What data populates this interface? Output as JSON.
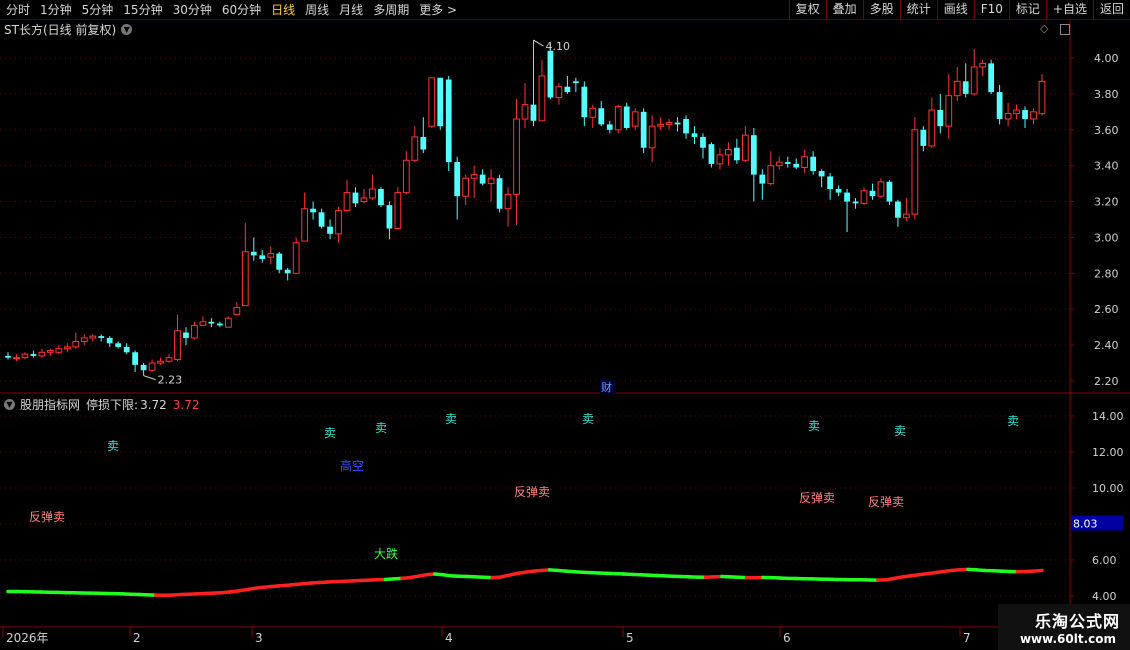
{
  "toolbar": {
    "periods": [
      "分时",
      "1分钟",
      "5分钟",
      "15分钟",
      "30分钟",
      "60分钟",
      "日线",
      "周线",
      "月线",
      "多周期",
      "更多"
    ],
    "active_period": "日线",
    "more_arrow": ">",
    "buttons": [
      "复权",
      "叠加",
      "多股",
      "统计",
      "画线",
      "F10",
      "标记",
      "+自选",
      "返回"
    ]
  },
  "main_chart": {
    "title": "ST长方(日线 前复权)",
    "icons": [
      "diamond-icon",
      "window-icon"
    ],
    "y_ticks": [
      "4.00",
      "3.80",
      "3.60",
      "3.40",
      "3.20",
      "3.00",
      "2.80",
      "2.60",
      "2.40",
      "2.20"
    ],
    "high_label": "4.10",
    "low_label": "2.23",
    "marker": "财"
  },
  "indicator": {
    "name": "股朋指标网",
    "stop_label": "停损下限:",
    "stop_value": "3.72",
    "stop_value_red": "3.72",
    "y_ticks": [
      "14.00",
      "12.00",
      "10.00",
      "8.00",
      "6.00",
      "4.00"
    ],
    "current_value": "8.03",
    "signals": [
      {
        "text": "卖",
        "color": "#40e0d0"
      },
      {
        "text": "卖",
        "color": "#40e0d0"
      },
      {
        "text": "卖",
        "color": "#40e0d0"
      },
      {
        "text": "卖",
        "color": "#40e0d0"
      },
      {
        "text": "卖",
        "color": "#40e0d0"
      },
      {
        "text": "卖",
        "color": "#40e0d0"
      },
      {
        "text": "卖",
        "color": "#40e0d0"
      },
      {
        "text": "卖",
        "color": "#40e0d0"
      },
      {
        "text": "高空",
        "color": "#3050ff"
      },
      {
        "text": "反弹卖",
        "color": "#ff8080"
      },
      {
        "text": "反弹卖",
        "color": "#ff8080"
      },
      {
        "text": "反弹卖",
        "color": "#ff8080"
      },
      {
        "text": "反弹卖",
        "color": "#ff8080"
      },
      {
        "text": "大跌",
        "color": "#40ff40"
      }
    ]
  },
  "x_axis": {
    "labels": [
      "2026年",
      "2",
      "3",
      "4",
      "5",
      "6",
      "7"
    ]
  },
  "chart_data": {
    "type": "candlestick",
    "title": "ST长方(日线 前复权)",
    "ylim": [
      2.13,
      4.16
    ],
    "candles": [
      [
        2.34,
        2.33,
        2.36,
        2.32
      ],
      [
        2.33,
        2.33,
        2.35,
        2.31
      ],
      [
        2.33,
        2.35,
        2.36,
        2.32
      ],
      [
        2.35,
        2.34,
        2.37,
        2.33
      ],
      [
        2.34,
        2.36,
        2.38,
        2.33
      ],
      [
        2.36,
        2.37,
        2.38,
        2.34
      ],
      [
        2.36,
        2.38,
        2.4,
        2.35
      ],
      [
        2.38,
        2.39,
        2.41,
        2.36
      ],
      [
        2.39,
        2.42,
        2.47,
        2.38
      ],
      [
        2.42,
        2.44,
        2.46,
        2.4
      ],
      [
        2.44,
        2.45,
        2.46,
        2.42
      ],
      [
        2.45,
        2.44,
        2.46,
        2.42
      ],
      [
        2.44,
        2.41,
        2.45,
        2.39
      ],
      [
        2.41,
        2.39,
        2.42,
        2.38
      ],
      [
        2.39,
        2.36,
        2.41,
        2.35
      ],
      [
        2.36,
        2.29,
        2.37,
        2.25
      ],
      [
        2.29,
        2.26,
        2.3,
        2.23
      ],
      [
        2.26,
        2.3,
        2.32,
        2.25
      ],
      [
        2.3,
        2.31,
        2.33,
        2.29
      ],
      [
        2.31,
        2.33,
        2.35,
        2.3
      ],
      [
        2.32,
        2.48,
        2.57,
        2.31
      ],
      [
        2.47,
        2.44,
        2.5,
        2.4
      ],
      [
        2.44,
        2.51,
        2.53,
        2.43
      ],
      [
        2.51,
        2.53,
        2.56,
        2.51
      ],
      [
        2.53,
        2.52,
        2.55,
        2.5
      ],
      [
        2.52,
        2.51,
        2.53,
        2.5
      ],
      [
        2.5,
        2.55,
        2.56,
        2.5
      ],
      [
        2.57,
        2.61,
        2.64,
        2.58
      ],
      [
        2.62,
        2.92,
        3.08,
        2.62
      ],
      [
        2.92,
        2.9,
        3.0,
        2.87
      ],
      [
        2.9,
        2.88,
        2.93,
        2.86
      ],
      [
        2.89,
        2.91,
        2.95,
        2.85
      ],
      [
        2.91,
        2.82,
        2.92,
        2.8
      ],
      [
        2.82,
        2.8,
        2.83,
        2.76
      ],
      [
        2.8,
        2.97,
        3.0,
        2.8
      ],
      [
        2.98,
        3.16,
        3.25,
        2.98
      ],
      [
        3.16,
        3.14,
        3.2,
        3.1
      ],
      [
        3.14,
        3.06,
        3.16,
        3.05
      ],
      [
        3.06,
        3.02,
        3.1,
        2.99
      ],
      [
        3.02,
        3.15,
        3.17,
        2.97
      ],
      [
        3.15,
        3.25,
        3.32,
        3.14
      ],
      [
        3.25,
        3.19,
        3.28,
        3.17
      ],
      [
        3.2,
        3.22,
        3.27,
        3.19
      ],
      [
        3.22,
        3.27,
        3.35,
        3.21
      ],
      [
        3.27,
        3.18,
        3.28,
        3.17
      ],
      [
        3.18,
        3.05,
        3.2,
        2.99
      ],
      [
        3.05,
        3.25,
        3.28,
        3.04
      ],
      [
        3.25,
        3.43,
        3.48,
        3.24
      ],
      [
        3.43,
        3.56,
        3.62,
        3.42
      ],
      [
        3.56,
        3.49,
        3.67,
        3.47
      ],
      [
        3.62,
        3.89,
        3.89,
        3.61
      ],
      [
        3.89,
        3.62,
        3.89,
        3.6
      ],
      [
        3.88,
        3.42,
        3.9,
        3.37
      ],
      [
        3.42,
        3.23,
        3.45,
        3.1
      ],
      [
        3.23,
        3.33,
        3.35,
        3.18
      ],
      [
        3.33,
        3.35,
        3.4,
        3.22
      ],
      [
        3.35,
        3.3,
        3.38,
        3.29
      ],
      [
        3.3,
        3.33,
        3.38,
        3.2
      ],
      [
        3.33,
        3.16,
        3.35,
        3.14
      ],
      [
        3.16,
        3.24,
        3.28,
        3.06
      ],
      [
        3.24,
        3.66,
        3.77,
        3.07
      ],
      [
        3.66,
        3.74,
        3.86,
        3.61
      ],
      [
        3.74,
        3.65,
        4.1,
        3.62
      ],
      [
        3.65,
        3.9,
        3.99,
        3.66
      ],
      [
        4.04,
        3.78,
        4.08,
        3.77
      ],
      [
        3.78,
        3.84,
        3.86,
        3.74
      ],
      [
        3.84,
        3.81,
        3.9,
        3.8
      ],
      [
        3.87,
        3.86,
        3.89,
        3.81
      ],
      [
        3.84,
        3.67,
        3.87,
        3.62
      ],
      [
        3.67,
        3.72,
        3.74,
        3.61
      ],
      [
        3.72,
        3.63,
        3.76,
        3.62
      ],
      [
        3.63,
        3.6,
        3.65,
        3.58
      ],
      [
        3.6,
        3.73,
        3.74,
        3.58
      ],
      [
        3.73,
        3.61,
        3.75,
        3.6
      ],
      [
        3.62,
        3.7,
        3.72,
        3.6
      ],
      [
        3.7,
        3.5,
        3.72,
        3.47
      ],
      [
        3.5,
        3.62,
        3.68,
        3.42
      ],
      [
        3.62,
        3.63,
        3.67,
        3.6
      ],
      [
        3.63,
        3.64,
        3.66,
        3.6
      ],
      [
        3.64,
        3.63,
        3.67,
        3.59
      ],
      [
        3.66,
        3.58,
        3.68,
        3.55
      ],
      [
        3.58,
        3.56,
        3.62,
        3.52
      ],
      [
        3.56,
        3.5,
        3.58,
        3.44
      ],
      [
        3.52,
        3.41,
        3.53,
        3.39
      ],
      [
        3.41,
        3.46,
        3.5,
        3.38
      ],
      [
        3.46,
        3.49,
        3.53,
        3.4
      ],
      [
        3.5,
        3.43,
        3.55,
        3.41
      ],
      [
        3.43,
        3.57,
        3.62,
        3.42
      ],
      [
        3.57,
        3.35,
        3.61,
        3.2
      ],
      [
        3.35,
        3.3,
        3.38,
        3.21
      ],
      [
        3.3,
        3.4,
        3.48,
        3.29
      ],
      [
        3.4,
        3.42,
        3.45,
        3.38
      ],
      [
        3.42,
        3.41,
        3.45,
        3.39
      ],
      [
        3.41,
        3.39,
        3.44,
        3.38
      ],
      [
        3.39,
        3.45,
        3.49,
        3.36
      ],
      [
        3.45,
        3.37,
        3.48,
        3.35
      ],
      [
        3.37,
        3.34,
        3.38,
        3.28
      ],
      [
        3.34,
        3.27,
        3.36,
        3.21
      ],
      [
        3.27,
        3.25,
        3.29,
        3.23
      ],
      [
        3.25,
        3.2,
        3.27,
        3.03
      ],
      [
        3.2,
        3.19,
        3.22,
        3.16
      ],
      [
        3.19,
        3.26,
        3.28,
        3.18
      ],
      [
        3.26,
        3.23,
        3.3,
        3.21
      ],
      [
        3.23,
        3.31,
        3.33,
        3.22
      ],
      [
        3.31,
        3.2,
        3.32,
        3.18
      ],
      [
        3.2,
        3.11,
        3.21,
        3.06
      ],
      [
        3.11,
        3.13,
        3.22,
        3.09
      ],
      [
        3.13,
        3.6,
        3.67,
        3.1
      ],
      [
        3.6,
        3.51,
        3.62,
        3.48
      ],
      [
        3.51,
        3.71,
        3.78,
        3.5
      ],
      [
        3.71,
        3.62,
        3.8,
        3.58
      ],
      [
        3.62,
        3.79,
        3.91,
        3.55
      ],
      [
        3.79,
        3.87,
        3.95,
        3.76
      ],
      [
        3.87,
        3.8,
        3.97,
        3.78
      ],
      [
        3.8,
        3.95,
        4.05,
        3.79
      ],
      [
        3.95,
        3.97,
        3.99,
        3.9
      ],
      [
        3.97,
        3.81,
        3.99,
        3.8
      ],
      [
        3.81,
        3.66,
        3.85,
        3.63
      ],
      [
        3.66,
        3.69,
        3.75,
        3.62
      ],
      [
        3.69,
        3.71,
        3.74,
        3.66
      ],
      [
        3.71,
        3.66,
        3.73,
        3.61
      ],
      [
        3.66,
        3.7,
        3.72,
        3.63
      ],
      [
        3.69,
        3.87,
        3.91,
        3.68
      ]
    ],
    "indicator_line": {
      "ylim": [
        3.9,
        14.8
      ],
      "points": [
        [
          4.25,
          "g"
        ],
        [
          4.25,
          "g"
        ],
        [
          4.24,
          "g"
        ],
        [
          4.23,
          "g"
        ],
        [
          4.22,
          "g"
        ],
        [
          4.21,
          "g"
        ],
        [
          4.2,
          "g"
        ],
        [
          4.19,
          "g"
        ],
        [
          4.18,
          "g"
        ],
        [
          4.17,
          "g"
        ],
        [
          4.16,
          "g"
        ],
        [
          4.15,
          "g"
        ],
        [
          4.14,
          "g"
        ],
        [
          4.13,
          "g"
        ],
        [
          4.12,
          "g"
        ],
        [
          4.1,
          "g"
        ],
        [
          4.08,
          "g"
        ],
        [
          4.06,
          "g"
        ],
        [
          4.05,
          "g"
        ],
        [
          4.04,
          "r"
        ],
        [
          4.05,
          "r"
        ],
        [
          4.08,
          "r"
        ],
        [
          4.1,
          "r"
        ],
        [
          4.12,
          "r"
        ],
        [
          4.14,
          "r"
        ],
        [
          4.16,
          "r"
        ],
        [
          4.18,
          "r"
        ],
        [
          4.22,
          "r"
        ],
        [
          4.28,
          "r"
        ],
        [
          4.35,
          "r"
        ],
        [
          4.42,
          "r"
        ],
        [
          4.48,
          "r"
        ],
        [
          4.52,
          "r"
        ],
        [
          4.56,
          "r"
        ],
        [
          4.6,
          "r"
        ],
        [
          4.64,
          "r"
        ],
        [
          4.68,
          "r"
        ],
        [
          4.72,
          "r"
        ],
        [
          4.75,
          "r"
        ],
        [
          4.78,
          "r"
        ],
        [
          4.8,
          "r"
        ],
        [
          4.82,
          "r"
        ],
        [
          4.84,
          "r"
        ],
        [
          4.86,
          "r"
        ],
        [
          4.88,
          "r"
        ],
        [
          4.9,
          "r"
        ],
        [
          4.92,
          "r"
        ],
        [
          4.95,
          "g"
        ],
        [
          4.98,
          "g"
        ],
        [
          5.02,
          "r"
        ],
        [
          5.1,
          "r"
        ],
        [
          5.18,
          "r"
        ],
        [
          5.22,
          "r"
        ],
        [
          5.18,
          "g"
        ],
        [
          5.12,
          "g"
        ],
        [
          5.1,
          "g"
        ],
        [
          5.08,
          "g"
        ],
        [
          5.06,
          "g"
        ],
        [
          5.04,
          "g"
        ],
        [
          5.02,
          "g"
        ],
        [
          5.05,
          "r"
        ],
        [
          5.15,
          "r"
        ],
        [
          5.25,
          "r"
        ],
        [
          5.32,
          "r"
        ],
        [
          5.38,
          "r"
        ],
        [
          5.42,
          "r"
        ],
        [
          5.45,
          "r"
        ],
        [
          5.42,
          "g"
        ],
        [
          5.38,
          "g"
        ],
        [
          5.35,
          "g"
        ],
        [
          5.32,
          "g"
        ],
        [
          5.3,
          "g"
        ],
        [
          5.28,
          "g"
        ],
        [
          5.26,
          "g"
        ],
        [
          5.24,
          "g"
        ],
        [
          5.22,
          "g"
        ],
        [
          5.2,
          "g"
        ],
        [
          5.18,
          "g"
        ],
        [
          5.16,
          "g"
        ],
        [
          5.14,
          "g"
        ],
        [
          5.12,
          "g"
        ],
        [
          5.1,
          "g"
        ],
        [
          5.08,
          "g"
        ],
        [
          5.06,
          "g"
        ],
        [
          5.05,
          "g"
        ],
        [
          5.04,
          "g"
        ],
        [
          5.06,
          "r"
        ],
        [
          5.08,
          "r"
        ],
        [
          5.06,
          "g"
        ],
        [
          5.04,
          "g"
        ],
        [
          5.02,
          "g"
        ],
        [
          5.01,
          "r"
        ],
        [
          5.03,
          "r"
        ],
        [
          5.02,
          "g"
        ],
        [
          5.0,
          "g"
        ],
        [
          4.98,
          "g"
        ],
        [
          4.97,
          "g"
        ],
        [
          4.96,
          "g"
        ],
        [
          4.95,
          "g"
        ],
        [
          4.94,
          "g"
        ],
        [
          4.93,
          "g"
        ],
        [
          4.92,
          "g"
        ],
        [
          4.91,
          "g"
        ],
        [
          4.9,
          "g"
        ],
        [
          4.9,
          "g"
        ],
        [
          4.89,
          "g"
        ],
        [
          4.88,
          "g"
        ],
        [
          4.9,
          "r"
        ],
        [
          4.98,
          "r"
        ],
        [
          5.06,
          "r"
        ],
        [
          5.12,
          "r"
        ],
        [
          5.18,
          "r"
        ],
        [
          5.24,
          "r"
        ],
        [
          5.3,
          "r"
        ],
        [
          5.36,
          "r"
        ],
        [
          5.42,
          "r"
        ],
        [
          5.46,
          "r"
        ],
        [
          5.48,
          "r"
        ],
        [
          5.45,
          "g"
        ],
        [
          5.42,
          "g"
        ],
        [
          5.4,
          "g"
        ],
        [
          5.38,
          "g"
        ],
        [
          5.36,
          "g"
        ],
        [
          5.35,
          "g"
        ],
        [
          5.36,
          "r"
        ],
        [
          5.38,
          "r"
        ],
        [
          5.42,
          "r"
        ]
      ]
    }
  }
}
